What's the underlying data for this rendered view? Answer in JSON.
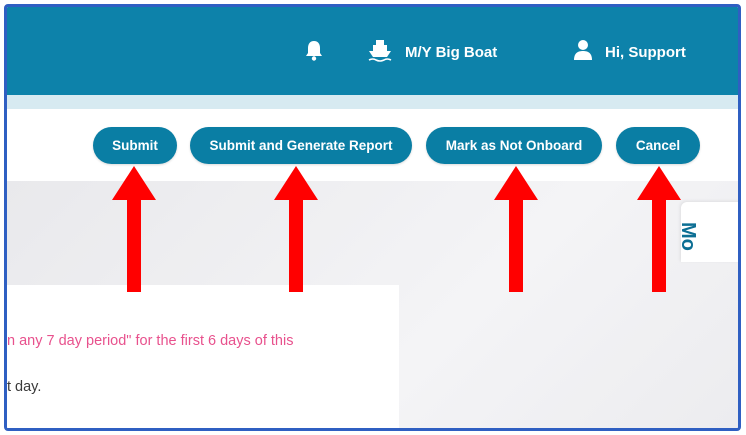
{
  "header": {
    "vessel_name": "M/Y Big Boat",
    "greeting": "Hi, Support"
  },
  "toolbar": {
    "buttons": [
      {
        "label": "Submit"
      },
      {
        "label": "Submit and Generate Report"
      },
      {
        "label": "Mark as Not Onboard"
      },
      {
        "label": "Cancel"
      }
    ]
  },
  "content": {
    "rule_text": "n any 7 day period\" for the first 6 days of this",
    "day_text": "t day.",
    "side_tab_label": "Mo"
  },
  "colors": {
    "header_bg": "#0d82aa",
    "button_bg": "#0a7ea4",
    "accent_pink": "#e8518d",
    "annotation_arrow": "#ff0000",
    "frame_border": "#2f5fc2"
  },
  "icons": {
    "notification": "bell-icon",
    "vessel": "ship-icon",
    "user": "user-icon"
  }
}
